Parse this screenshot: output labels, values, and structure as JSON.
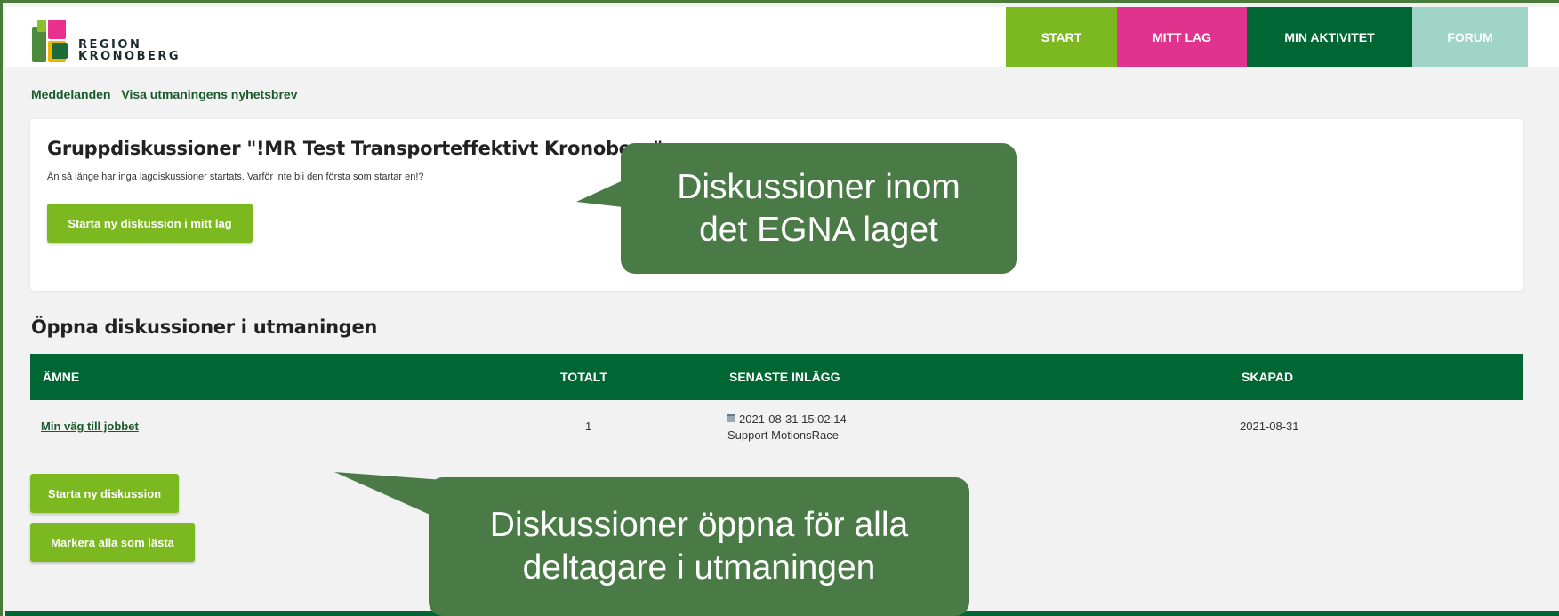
{
  "brand": {
    "line1": "REGION",
    "line2": "KRONOBERG"
  },
  "nav": {
    "start": "START",
    "mitt_lag": "MITT LAG",
    "min_aktivitet": "MIN AKTIVITET",
    "forum": "FORUM"
  },
  "sublinks": {
    "meddelanden": "Meddelanden",
    "nyhetsbrev": "Visa utmaningens nyhetsbrev"
  },
  "group_card": {
    "title": "Gruppdiskussioner \"!MR Test Transporteffektivt Kronoberg\"",
    "subtitle": "Än så länge har inga lagdiskussioner startats. Varför inte bli den första som startar en!?",
    "button": "Starta ny diskussion i mitt lag"
  },
  "open_section": {
    "title": "Öppna diskussioner i utmaningen",
    "columns": {
      "topic": "ÄMNE",
      "total": "TOTALT",
      "latest": "SENASTE INLÄGG",
      "created": "SKAPAD"
    },
    "rows": [
      {
        "topic": "Min väg till jobbet",
        "total": "1",
        "latest_date": "2021-08-31 15:02:14",
        "latest_author": "Support MotionsRace",
        "created": "2021-08-31"
      }
    ],
    "new_button": "Starta ny diskussion",
    "mark_read_button": "Markera alla som lästa"
  },
  "callouts": {
    "own_team_line1": "Diskussioner inom",
    "own_team_line2": "det EGNA laget",
    "open_line1": "Diskussioner öppna för alla",
    "open_line2": "deltagare i utmaningen"
  },
  "colors": {
    "green_dark": "#006633",
    "green_light": "#7cb81f",
    "pink": "#e0338e",
    "mint": "#9fd4c6",
    "callout": "#4a7a45"
  }
}
